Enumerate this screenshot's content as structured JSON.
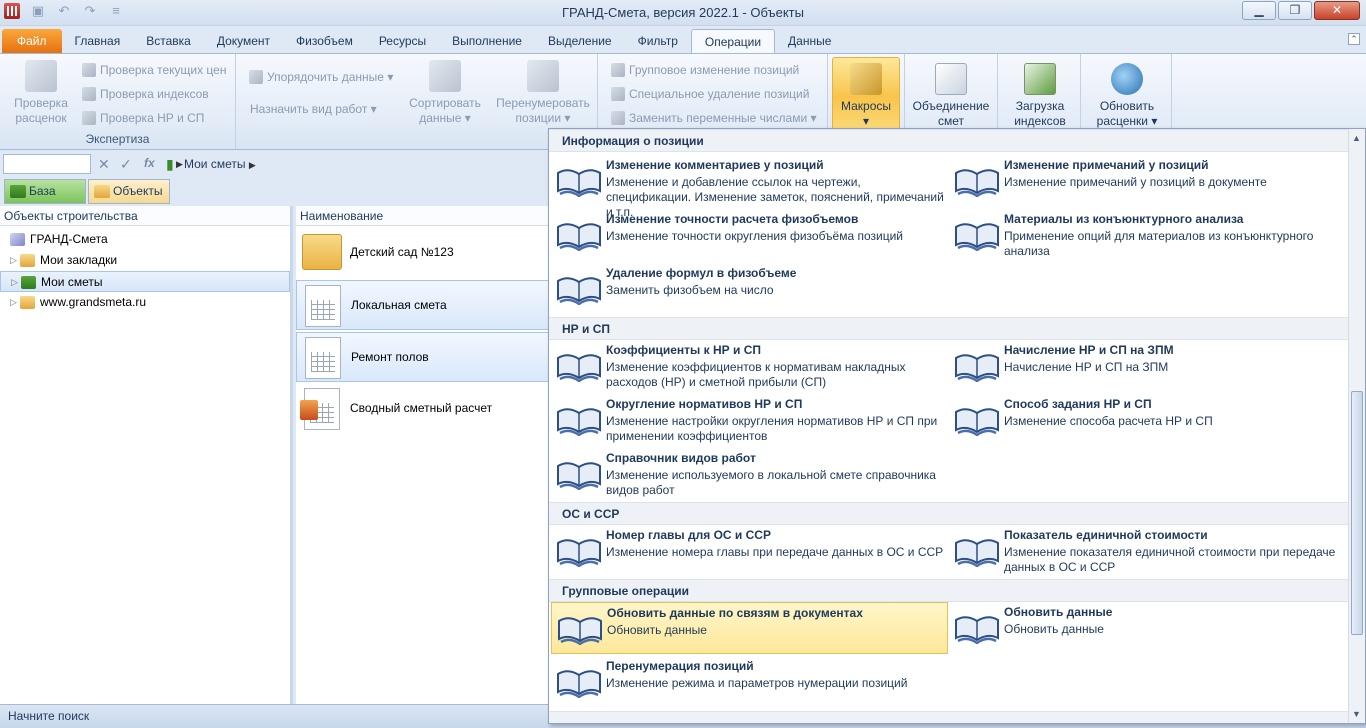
{
  "window": {
    "title": "ГРАНД-Смета, версия 2022.1 - Объекты",
    "controls": [
      "minimize",
      "maximize",
      "close"
    ]
  },
  "ribbon_tabs": [
    "Файл",
    "Главная",
    "Вставка",
    "Документ",
    "Физобъем",
    "Ресурсы",
    "Выполнение",
    "Выделение",
    "Фильтр",
    "Операции",
    "Данные"
  ],
  "active_tab": "Операции",
  "ribbon": {
    "expertiza": {
      "check_rates": [
        "Проверка",
        "расценок"
      ],
      "check_prices": "Проверка текущих цен",
      "check_indexes": "Проверка индексов",
      "check_nr_sp": "Проверка НР и СП",
      "label": "Экспертиза"
    },
    "sort_data": "Упорядочить данные",
    "assign_work_type": "Назначить вид работ",
    "sort": [
      "Сортировать",
      "данные"
    ],
    "renumber": [
      "Перенумеровать",
      "позиции"
    ],
    "group_change": "Групповое изменение позиций",
    "special_delete": "Специальное удаление позиций",
    "replace_vars": "Заменить переменные числами",
    "macros": "Макросы",
    "merge": [
      "Объединение",
      "смет"
    ],
    "load_indexes": [
      "Загрузка",
      "индексов"
    ],
    "update_rates": [
      "Обновить",
      "расценки"
    ]
  },
  "formula_bar": {
    "breadcrumb": "Мои сметы"
  },
  "nav_tabs": [
    "База",
    "Объекты"
  ],
  "left_panel": {
    "header": "Объекты строительства",
    "items": [
      "ГРАНД-Смета",
      "Мои закладки",
      "Мои сметы",
      "www.grandsmeta.ru"
    ]
  },
  "mid_panel": {
    "header": "Наименование",
    "items": [
      "Детский сад №123",
      "Локальная смета",
      "Ремонт полов",
      "Сводный сметный расчет"
    ]
  },
  "status": "Начните поиск",
  "macros_menu": {
    "sections": [
      {
        "title": "Информация о позиции",
        "items": [
          {
            "title": "Изменение комментариев у позиций",
            "desc": "Изменение и добавление ссылок на чертежи, спецификации. Изменение заметок, пояснений, примечаний и т.п."
          },
          {
            "title": "Изменение примечаний у позиций",
            "desc": "Изменение примечаний у позиций в документе"
          },
          {
            "title": "Изменение точности расчета физобъемов",
            "desc": "Изменение точности округления физобъёма позиций"
          },
          {
            "title": "Материалы из конъюнктурного анализа",
            "desc": "Применение опций для материалов из конъюнктурного анализа"
          },
          {
            "title": "Удаление формул в физобъеме",
            "desc": "Заменить физобъем на число"
          }
        ]
      },
      {
        "title": "НР и СП",
        "items": [
          {
            "title": "Коэффициенты к НР и СП",
            "desc": "Изменение коэффициентов к нормативам накладных расходов (НР) и сметной прибыли (СП)"
          },
          {
            "title": "Начисление НР и СП на ЗПМ",
            "desc": "Начисление НР и СП на ЗПМ"
          },
          {
            "title": "Округление нормативов НР и СП",
            "desc": "Изменение настройки округления нормативов НР и СП при применении коэффициентов"
          },
          {
            "title": "Способ задания НР и СП",
            "desc": "Изменение способа расчета НР и СП"
          },
          {
            "title": "Справочник видов работ",
            "desc": "Изменение используемого в локальной смете справочника видов работ"
          }
        ]
      },
      {
        "title": "ОС и ССР",
        "items": [
          {
            "title": "Номер главы для ОС и ССР",
            "desc": "Изменение номера главы при передаче данных в ОС и ССР"
          },
          {
            "title": "Показатель единичной стоимости",
            "desc": "Изменение показателя единичной стоимости при передаче данных в ОС и ССР"
          }
        ]
      },
      {
        "title": "Групповые операции",
        "items": [
          {
            "title": "Обновить данные по связям в документах",
            "desc": "Обновить данные"
          },
          {
            "title": "Обновить данные",
            "desc": "Обновить данные"
          },
          {
            "title": "Перенумерация позиций",
            "desc": "Изменение режима и параметров нумерации позиций"
          }
        ]
      }
    ],
    "highlighted_item": "Обновить данные по связям в документах"
  },
  "colors": {
    "accent_file_tab": "#e67112",
    "highlight": "#fde79a",
    "text": "#1e395b"
  }
}
